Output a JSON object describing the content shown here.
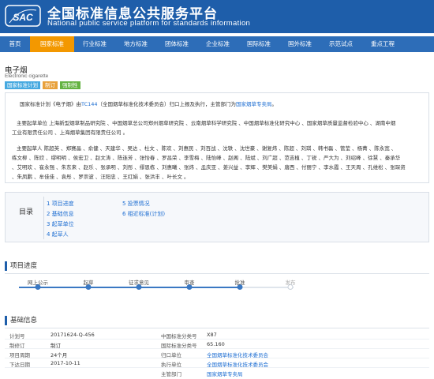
{
  "header": {
    "logo_text": "SAC",
    "title_cn": "全国标准信息公共服务平台",
    "title_en": "National public service platform  for standards information"
  },
  "nav": {
    "items": [
      "首页",
      "国家标准",
      "行业标准",
      "地方标准",
      "团体标准",
      "企业标准",
      "国际标准",
      "国外标准",
      "示范试点",
      "重点工程"
    ],
    "active_index": 1
  },
  "standard": {
    "name_cn": "电子烟",
    "name_en": "Electronic cigarette",
    "badges": [
      "国家标准计划",
      "制订",
      "强制性"
    ]
  },
  "info": {
    "line1_prefix": "国家标准计划《电子烟》由",
    "line1_tc": "TC144",
    "line1_mid": "（全国烟草标准化技术委员会）归口上报及执行，主管部门为",
    "line1_dept": "国家烟草专卖局",
    "line1_end": "。",
    "drafting_units_1": "主要起草单位 上海新型烟草制品研究院 、中国烟草总公司郑州烟草研究院 、云南烟草科学研究院 、中国烟草标准化研究中心 、国家烟草质量监督检验中心 、湖南中烟",
    "drafting_units_2": "工业有限责任公司 、上海烟草集团有限责任公司 。",
    "drafters_1": "主要起草人 陈超英 、郑赛晶 、俞健 、天建华 、吴达 、杜文 、陈欢 、刘惠民 、刘百战 、沈轶 、沈世豪 、谢复炜 、陈超 、刘琪 、韩书磊 、管莹 、杨菁 、陈永宽 、",
    "drafters_2": "练文柳 、陈欣 、缪明明 、侯宏卫 、赵文涛 、陈连芳 、张怡春 、罗昌荣 、李雪梅 、陆怡峰 、赵阁 、陆斌 、刘广超 、范吉植 、丁锐 、严大为 、刘绍峰 、徐慧 、秦承华",
    "drafters_3": "、艾明欢 、崔永强 、朱东来 、赵乐 、张承明 、刘彤 、缪恩栋 、刘惠曦 、张炜 、孟庆亚 、姜兴益 、李辉 、樊美娟 、唐西 、付丽宁 、李水霞 、王天周 、孔维松 、张琛资",
    "drafters_4": "、朱凤鹏 、牟佳佳 、袁彤 、罗崇波 、汪阳忠 、王红娟 、张洪丰 、叶长文 。"
  },
  "toc": {
    "title": "目录",
    "items": [
      "1 项目进度",
      "2 基础信息",
      "3 起草单位",
      "4 起草人",
      "5 投票情况",
      "6 相近标准(计划)"
    ]
  },
  "progress": {
    "section_title": "项目进度",
    "steps": [
      "网上公示",
      "起草",
      "征求意见",
      "审查",
      "批准",
      "发布"
    ],
    "completed_steps": 5
  },
  "basic_info": {
    "section_title": "基础信息",
    "left": [
      {
        "label": "计划号",
        "value": "20171624-Q-456"
      },
      {
        "label": "制修订",
        "value": "制订"
      },
      {
        "label": "项目周期",
        "value": "24个月"
      },
      {
        "label": "下达日期",
        "value": "2017-10-11"
      }
    ],
    "right": [
      {
        "label": "中国标准分类号",
        "value": "X87"
      },
      {
        "label": "国际标准分类号",
        "value": "65.160"
      },
      {
        "label": "归口单位",
        "value": "全国烟草标准化技术委员会"
      },
      {
        "label": "执行单位",
        "value": "全国烟草标准化技术委员会"
      },
      {
        "label": "主管部门",
        "value": "国家烟草专卖局"
      }
    ]
  },
  "colors": {
    "header_bg": "#1e5eaa",
    "nav_bg": "#2d6db8",
    "nav_active": "#f39800",
    "link": "#1e6ed2"
  }
}
